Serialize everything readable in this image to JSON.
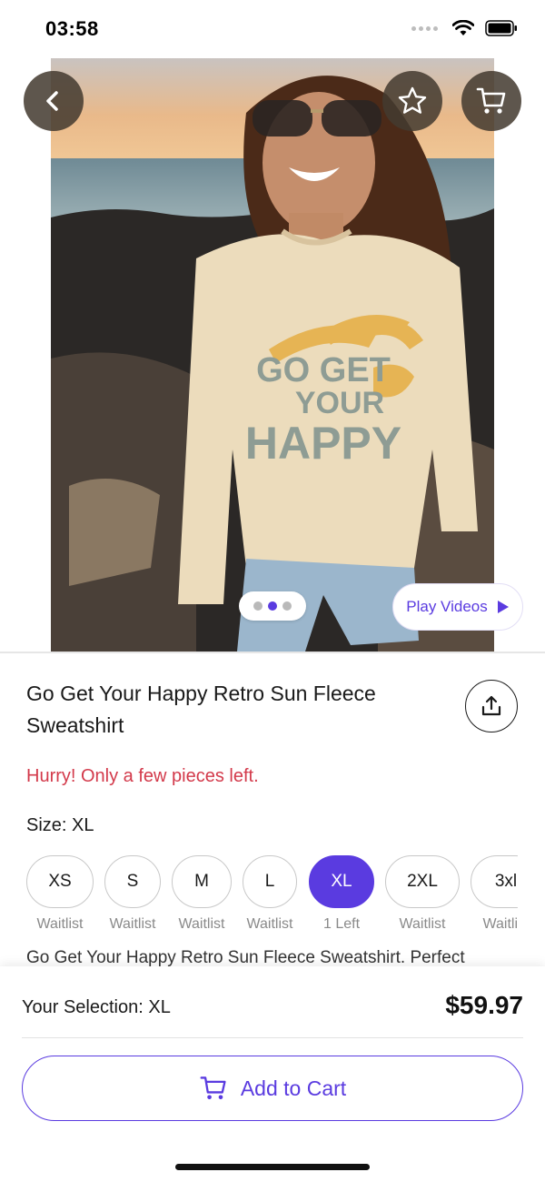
{
  "status_bar": {
    "time": "03:58"
  },
  "product": {
    "title": "Go Get Your Happy Retro Sun Fleece Sweatshirt",
    "stock_message": "Hurry! Only a few pieces left.",
    "size_label": "Size:",
    "selected_size": "XL",
    "description": "Go Get Your Happy Retro Sun Fleece Sweatshirt. Perfect",
    "image_print_text": [
      "GO GET",
      "YOUR",
      "HAPPY"
    ],
    "image_count": 3,
    "active_image": 2
  },
  "gallery": {
    "play_videos_label": "Play Videos"
  },
  "sizes": [
    {
      "label": "XS",
      "status": "Waitlist",
      "selected": false
    },
    {
      "label": "S",
      "status": "Waitlist",
      "selected": false
    },
    {
      "label": "M",
      "status": "Waitlist",
      "selected": false
    },
    {
      "label": "L",
      "status": "Waitlist",
      "selected": false
    },
    {
      "label": "XL",
      "status": "1 Left",
      "selected": true
    },
    {
      "label": "2XL",
      "status": "Waitlist",
      "selected": false
    },
    {
      "label": "3xl",
      "status": "Waitlist",
      "selected": false
    }
  ],
  "footer": {
    "selection_label": "Your Selection: XL",
    "price": "$59.97",
    "add_to_cart_label": "Add to Cart"
  },
  "colors": {
    "accent": "#5a3be0",
    "warning": "#d33a4b",
    "overlay_button": "#443a30"
  },
  "icons": {
    "back": "chevron-left-icon",
    "favorite": "star-icon",
    "cart": "cart-icon",
    "share": "share-icon",
    "play": "play-icon"
  }
}
